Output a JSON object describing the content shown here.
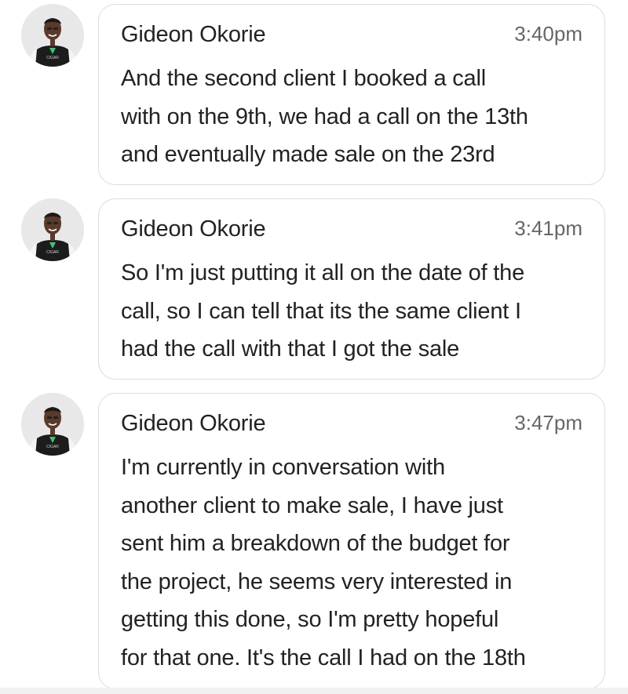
{
  "messages": [
    {
      "sender": "Gideon Okorie",
      "time": "3:40pm",
      "text": "And the second client I booked a call\nwith on the 9th, we had a call on the 13th\nand eventually made sale on the 23rd"
    },
    {
      "sender": "Gideon Okorie",
      "time": "3:41pm",
      "text": "So I'm just putting it all on the date of the\ncall, so I can tell that its the same client I\nhad the call with that I got the sale"
    },
    {
      "sender": "Gideon Okorie",
      "time": "3:47pm",
      "text": "I'm currently in conversation with\nanother client to make sale, I have just\nsent him a breakdown of the budget for\nthe project, he seems very interested in\ngetting this done, so I'm pretty hopeful\nfor that one. It's the call I had on the 18th"
    }
  ],
  "avatar": {
    "icon": "user-avatar-icon",
    "shirt_text": "CIGAR",
    "accent": "#3fc47a",
    "shirt_color": "#1c1c1c",
    "sleeve_color": "#f4f4f4"
  },
  "colors": {
    "bubble_border": "#dcdcdc",
    "text": "#222222",
    "time": "#666666"
  }
}
